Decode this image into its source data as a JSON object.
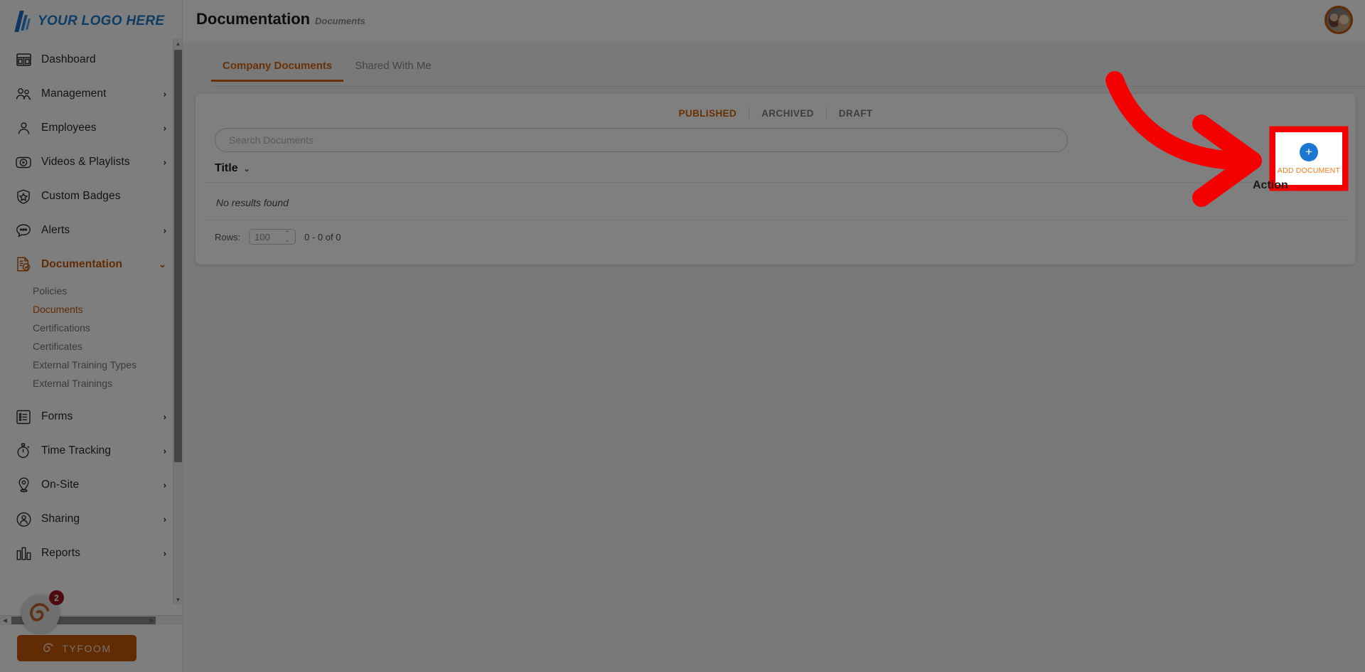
{
  "brand": {
    "logo_text": "YOUR LOGO HERE",
    "accent_orange": "#c25608",
    "accent_blue": "#1f78c8",
    "annotation_red": "#f50000"
  },
  "header": {
    "title": "Documentation",
    "subtitle": "Documents"
  },
  "sidebar": {
    "items": [
      {
        "label": "Dashboard",
        "icon": "dashboard-icon",
        "chevron": "",
        "active": false
      },
      {
        "label": "Management",
        "icon": "management-icon",
        "chevron": "›",
        "active": false
      },
      {
        "label": "Employees",
        "icon": "employees-icon",
        "chevron": "›",
        "active": false
      },
      {
        "label": "Videos & Playlists",
        "icon": "video-icon",
        "chevron": "›",
        "active": false
      },
      {
        "label": "Custom Badges",
        "icon": "badge-shield-icon",
        "chevron": "",
        "active": false
      },
      {
        "label": "Alerts",
        "icon": "alerts-chat-icon",
        "chevron": "›",
        "active": false
      },
      {
        "label": "Documentation",
        "icon": "documentation-icon",
        "chevron": "⌄",
        "active": true
      }
    ],
    "sub_items": [
      {
        "label": "Policies",
        "active": false
      },
      {
        "label": "Documents",
        "active": true
      },
      {
        "label": "Certifications",
        "active": false
      },
      {
        "label": "Certificates",
        "active": false
      },
      {
        "label": "External Training Types",
        "active": false
      },
      {
        "label": "External Trainings",
        "active": false
      }
    ],
    "items_after": [
      {
        "label": "Forms",
        "icon": "forms-icon",
        "chevron": "›",
        "active": false
      },
      {
        "label": "Time Tracking",
        "icon": "stopwatch-icon",
        "chevron": "›",
        "active": false
      },
      {
        "label": "On-Site",
        "icon": "map-pin-icon",
        "chevron": "›",
        "active": false
      },
      {
        "label": "Sharing",
        "icon": "sharing-icon",
        "chevron": "›",
        "active": false
      },
      {
        "label": "Reports",
        "icon": "bar-chart-icon",
        "chevron": "›",
        "active": false
      }
    ],
    "tyfoom_button": "TYFOOM",
    "chat_badge": "2"
  },
  "main": {
    "tabs": [
      {
        "label": "Company Documents",
        "active": true
      },
      {
        "label": "Shared With Me",
        "active": false
      }
    ],
    "status_filters": [
      {
        "label": "PUBLISHED",
        "active": true
      },
      {
        "label": "ARCHIVED",
        "active": false
      },
      {
        "label": "DRAFT",
        "active": false
      }
    ],
    "search": {
      "value": "",
      "placeholder": "Search Documents"
    },
    "table": {
      "columns": [
        "Title",
        "Action"
      ],
      "sort_indicator": "⌄",
      "empty_message": "No results found",
      "rows": []
    },
    "pagination": {
      "rows_label": "Rows:",
      "rows_per_page": "100",
      "range_text": "0 - 0 of 0"
    },
    "add_document": {
      "label": "ADD DOCUMENT",
      "plus": "+"
    }
  }
}
